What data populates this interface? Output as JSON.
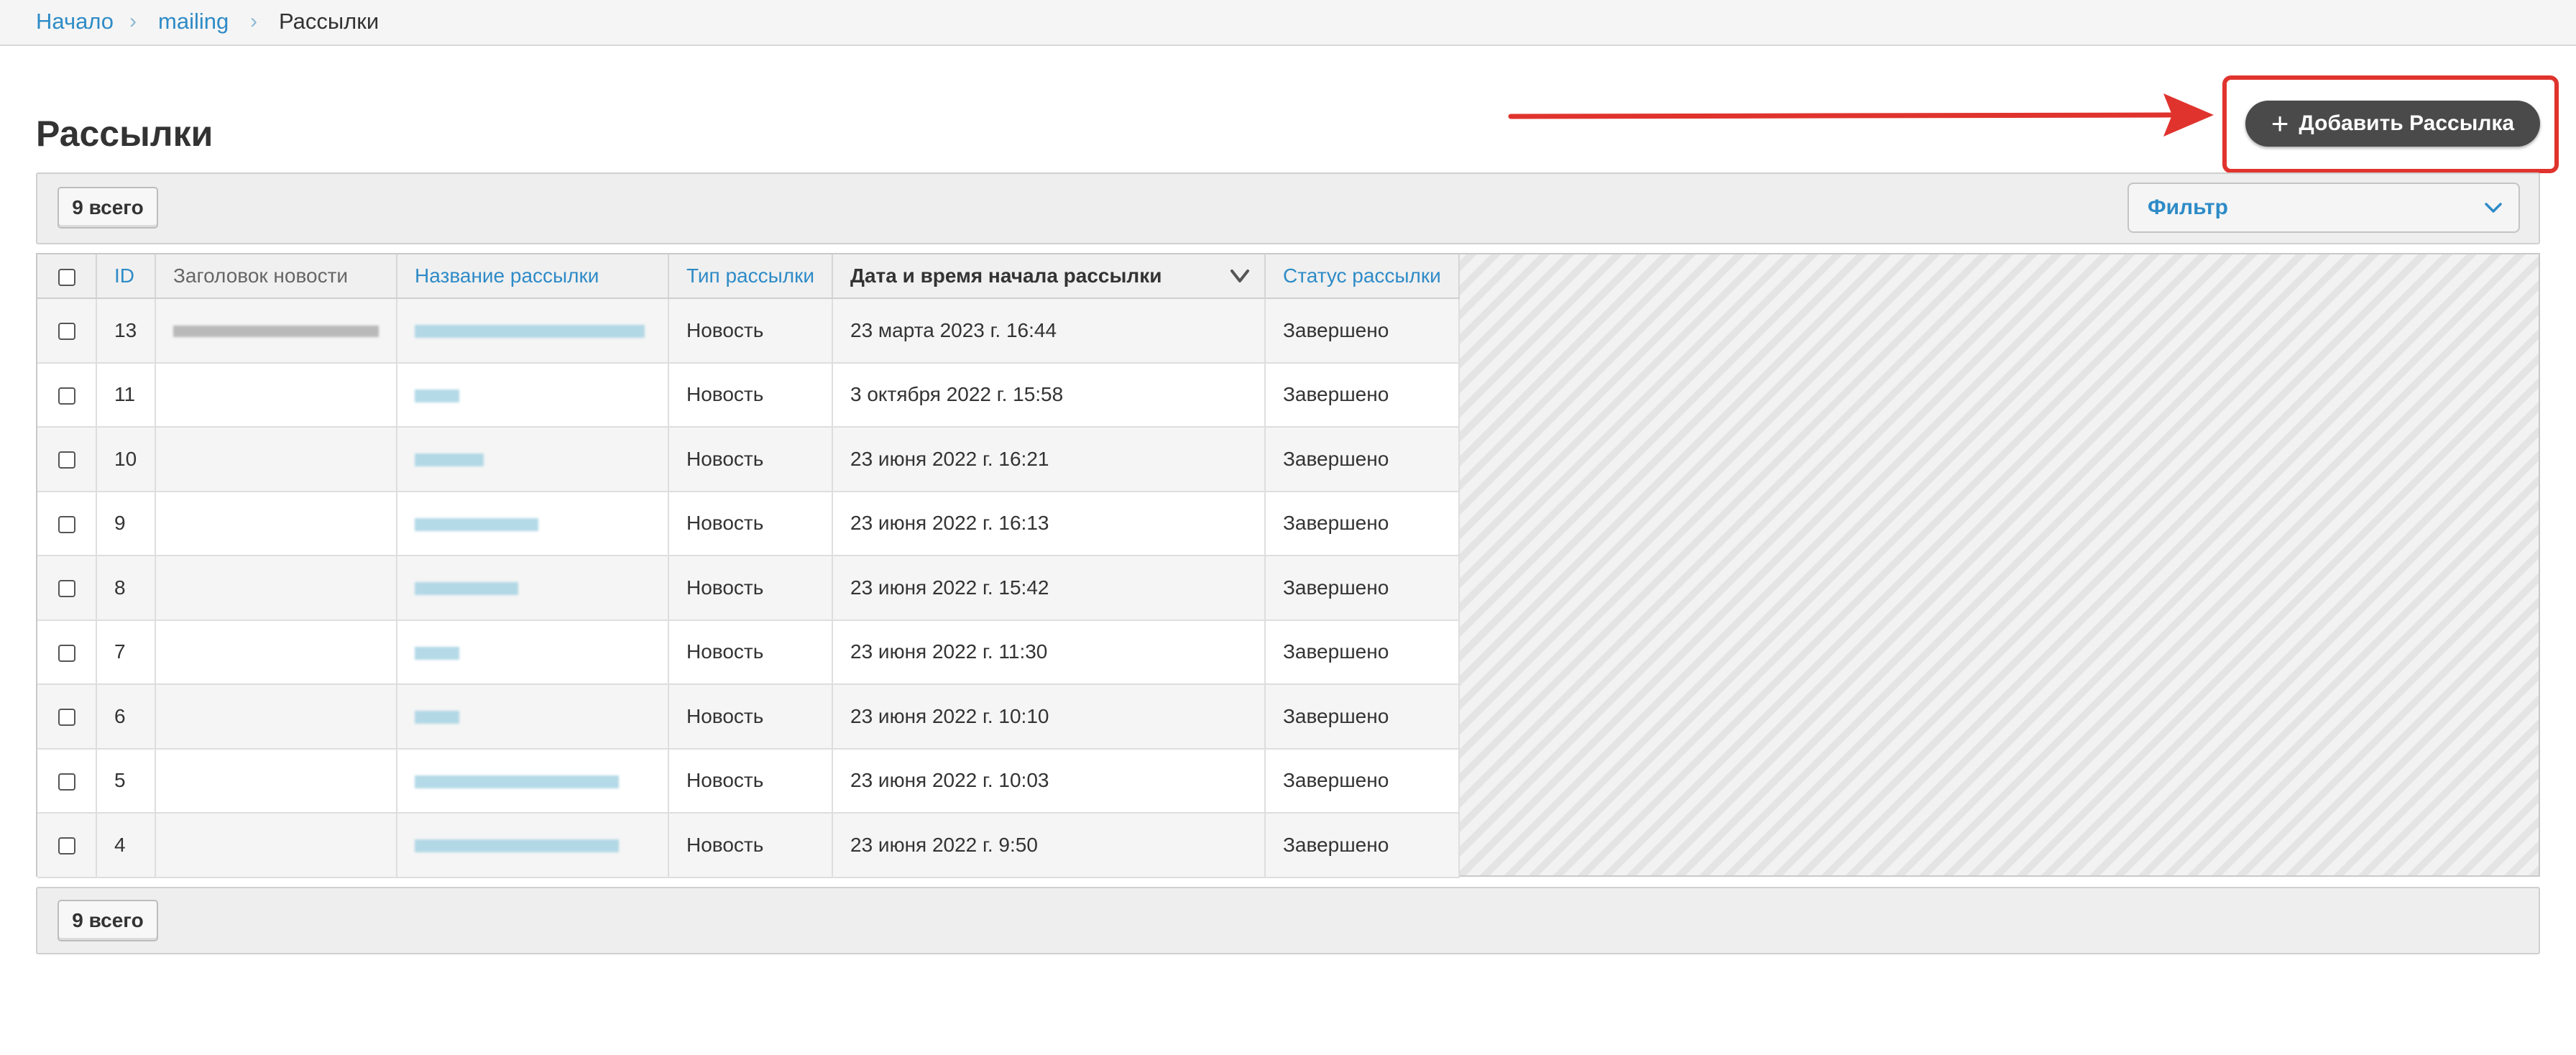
{
  "breadcrumb": {
    "home": "Начало",
    "section": "mailing",
    "current": "Рассылки"
  },
  "page_title": "Рассылки",
  "add_button_label": "Добавить Рассылка",
  "toolbar": {
    "count_top": "9 всего",
    "count_bottom": "9 всего",
    "filter_label": "Фильтр"
  },
  "table": {
    "columns": {
      "id": "ID",
      "news_title": "Заголовок новости",
      "mailing_name": "Название рассылки",
      "mailing_type": "Тип рассылки",
      "start_datetime": "Дата и время начала рассылки",
      "status": "Статус рассылки"
    },
    "rows": [
      {
        "id": "13",
        "type": "Новость",
        "date": "23 марта 2023 г. 16:44",
        "status": "Завершено"
      },
      {
        "id": "11",
        "type": "Новость",
        "date": "3 октября 2022 г. 15:58",
        "status": "Завершено"
      },
      {
        "id": "10",
        "type": "Новость",
        "date": "23 июня 2022 г. 16:21",
        "status": "Завершено"
      },
      {
        "id": "9",
        "type": "Новость",
        "date": "23 июня 2022 г. 16:13",
        "status": "Завершено"
      },
      {
        "id": "8",
        "type": "Новость",
        "date": "23 июня 2022 г. 15:42",
        "status": "Завершено"
      },
      {
        "id": "7",
        "type": "Новость",
        "date": "23 июня 2022 г. 11:30",
        "status": "Завершено"
      },
      {
        "id": "6",
        "type": "Новость",
        "date": "23 июня 2022 г. 10:10",
        "status": "Завершено"
      },
      {
        "id": "5",
        "type": "Новость",
        "date": "23 июня 2022 г. 10:03",
        "status": "Завершено"
      },
      {
        "id": "4",
        "type": "Новость",
        "date": "23 июня 2022 г. 9:50",
        "status": "Завершено"
      }
    ]
  },
  "colors": {
    "link": "#2e8bc7",
    "highlight": "#e0332d",
    "button": "#4a4a4a"
  },
  "icons": {
    "breadcrumb_separator": "chevron-right-icon",
    "add": "plus-icon",
    "filter": "chevron-down-icon",
    "sort": "sort-desc-icon"
  }
}
